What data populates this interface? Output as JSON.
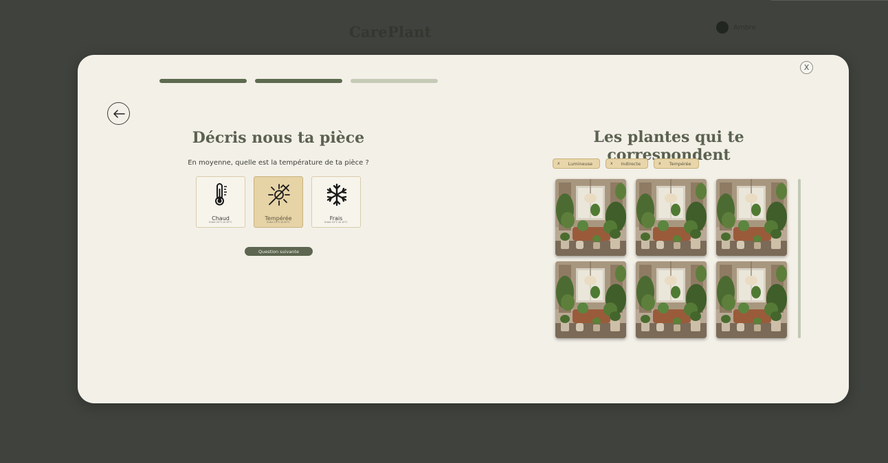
{
  "background": {
    "logo": "CarePlant",
    "user_name": "Ambre"
  },
  "modal": {
    "close_label": "X",
    "progress": {
      "total_steps": 3,
      "completed_steps": 2
    },
    "left": {
      "title": "Décris nous ta pièce",
      "question": "En moyenne, quelle est la température de ta pièce ?",
      "options": [
        {
          "label": "Chaud",
          "sub": "Entre 20°C et 25°C",
          "icon": "thermometer-icon",
          "selected": false
        },
        {
          "label": "Tempérée",
          "sub": "Entre 15°C et 20°C",
          "icon": "temperate-icon",
          "selected": true
        },
        {
          "label": "Frais",
          "sub": "Entre 10°C et 15°C",
          "icon": "snowflake-icon",
          "selected": false
        }
      ],
      "next_button": "Question suivante"
    },
    "right": {
      "title": "Les plantes qui te correspondent",
      "chips": [
        {
          "x": "x",
          "label": "Lumineuse"
        },
        {
          "x": "x",
          "label": "Indirecte"
        },
        {
          "x": "x",
          "label": "Tempérée"
        }
      ],
      "plant_cards": 6
    }
  },
  "colors": {
    "accent_green": "#5c6650",
    "beige_selected": "#e6d3a6",
    "modal_bg": "#f3f0e8",
    "overlay_bg": "#3f423d"
  }
}
